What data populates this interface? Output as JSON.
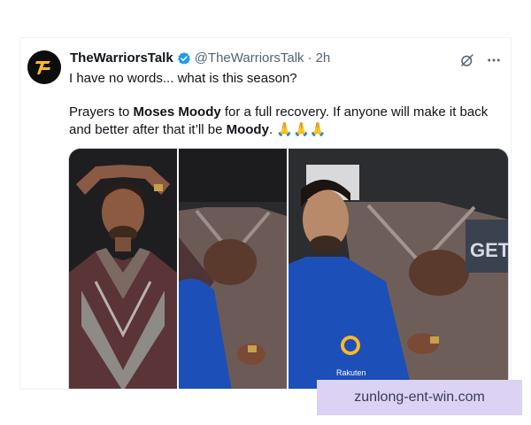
{
  "post": {
    "author_name": "TheWarriorsTalk",
    "handle": "@TheWarriorsTalk",
    "separator": "·",
    "time": "2h",
    "line1": "I have no words... what is this season?",
    "line2_a": "Prayers to ",
    "line2_name": "Moses Moody",
    "line2_b": " for a full recovery. If anyone will make it back and better after that it’ll be ",
    "line2_name2": "Moody",
    "line2_end": ". 🙏🙏🙏"
  },
  "icons": {
    "avatar": "warriors-logo-icon",
    "verified": "verified-badge-icon",
    "grok": "grok-icon",
    "more": "more-icon"
  },
  "photos": {
    "p2_jersey_logo": "",
    "p3_sponsor": "Rakuten",
    "p3_sign": "GET"
  },
  "watermark": "zunlong-ent-win.com",
  "colors": {
    "verified": "#1d9bf0",
    "warriors_gold": "#fdb927",
    "jersey_blue": "#1d4fb8",
    "muted": "#536471"
  }
}
